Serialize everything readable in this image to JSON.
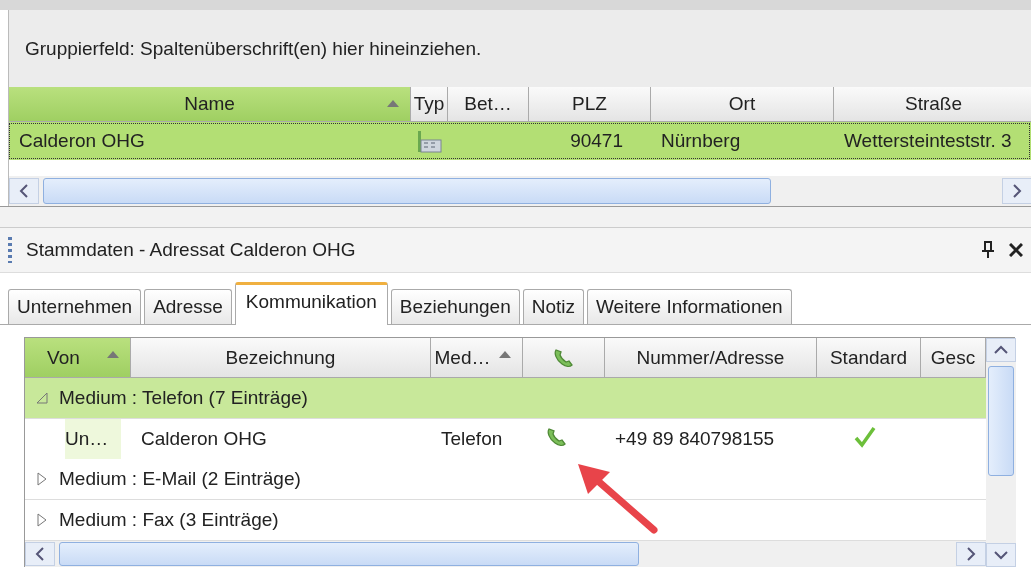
{
  "group_panel": {
    "hint": "Gruppierfeld: Spaltenüberschrift(en) hier hineinziehen."
  },
  "top_table": {
    "columns": [
      {
        "label": "Name",
        "highlighted": true,
        "sorted": true
      },
      {
        "label": "Typ",
        "highlighted": false,
        "sorted": false
      },
      {
        "label": "Bet…",
        "highlighted": false,
        "sorted": false
      },
      {
        "label": "PLZ",
        "highlighted": false,
        "sorted": false
      },
      {
        "label": "Ort",
        "highlighted": false,
        "sorted": false
      },
      {
        "label": "Straße",
        "highlighted": false,
        "sorted": false
      }
    ],
    "rows": [
      {
        "selected": true,
        "name": "Calderon OHG",
        "plz": "90471",
        "ort": "Nürnberg",
        "strasse": "Wettersteinteststr. 3"
      }
    ]
  },
  "panel": {
    "title": "Stammdaten - Adressat Calderon OHG",
    "tabs": [
      {
        "label": "Unternehmen",
        "selected": false
      },
      {
        "label": "Adresse",
        "selected": false
      },
      {
        "label": "Kommunikation",
        "selected": true
      },
      {
        "label": "Beziehungen",
        "selected": false
      },
      {
        "label": "Notiz",
        "selected": false
      },
      {
        "label": "Weitere Informationen",
        "selected": false
      }
    ],
    "grid": {
      "columns": [
        {
          "kind": "text",
          "label": "Von",
          "highlighted": true,
          "sorted": true
        },
        {
          "kind": "text",
          "label": "Bezeichnung",
          "highlighted": false,
          "sorted": false
        },
        {
          "kind": "text",
          "label": "Med…",
          "highlighted": false,
          "sorted": true
        },
        {
          "kind": "icon",
          "highlighted": false,
          "sorted": false
        },
        {
          "kind": "text",
          "label": "Nummer/Adresse",
          "highlighted": false,
          "sorted": false
        },
        {
          "kind": "text",
          "label": "Standard",
          "highlighted": false,
          "sorted": false
        },
        {
          "kind": "text",
          "label": "Gesc",
          "highlighted": false,
          "sorted": false
        }
      ],
      "groups": [
        {
          "label": "Medium : Telefon (7 Einträge)",
          "expanded": true,
          "selected": true,
          "rows": [
            {
              "von": "Un…",
              "bezeichnung": "Calderon OHG",
              "medium": "Telefon",
              "nummer": "+49 89 840798155",
              "standard": true
            }
          ]
        },
        {
          "label": "Medium : E-Mail (2 Einträge)",
          "expanded": false,
          "selected": false
        },
        {
          "label": "Medium : Fax (3 Einträge)",
          "expanded": false,
          "selected": false
        }
      ]
    }
  }
}
